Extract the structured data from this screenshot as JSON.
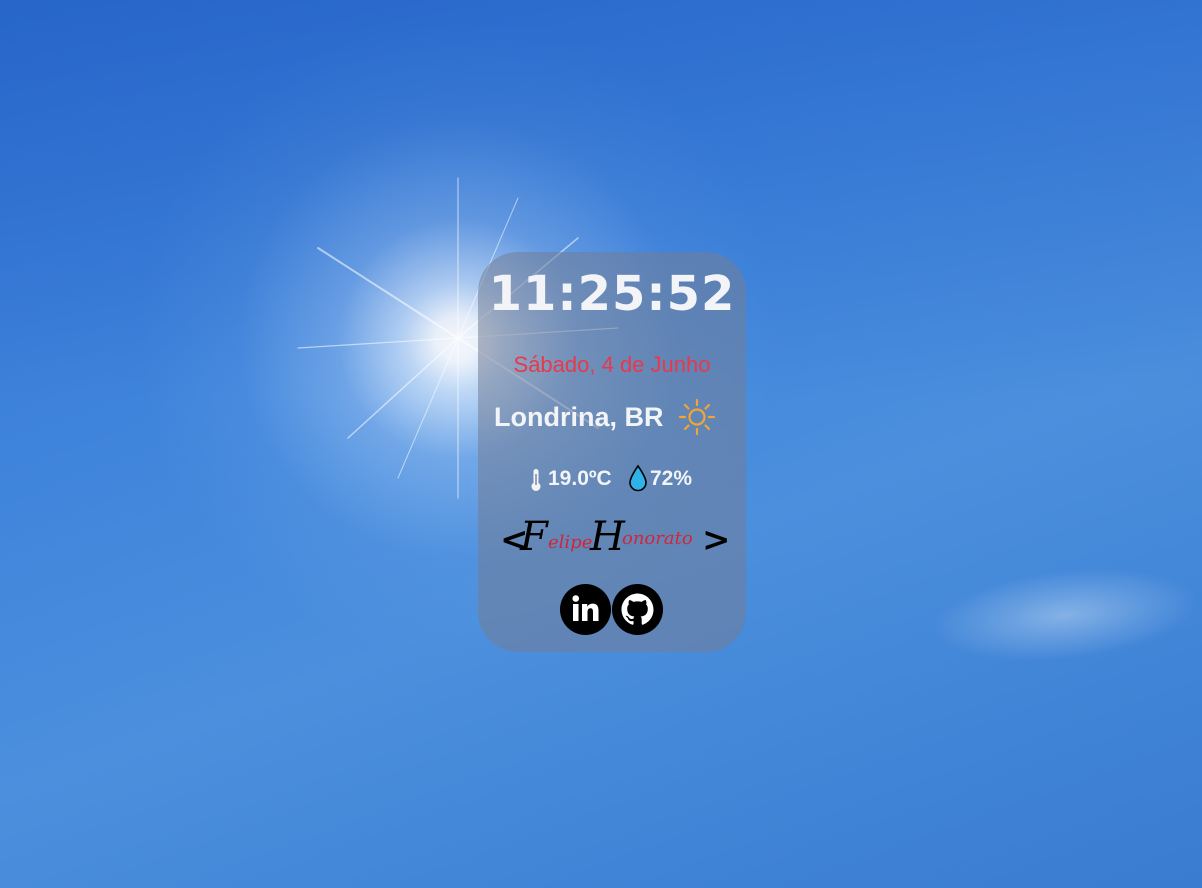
{
  "clock": {
    "time": "11:25:52"
  },
  "date": {
    "label": "Sábado, 4 de Junho"
  },
  "weather": {
    "city": "Londrina, BR",
    "condition_icon": "sun-icon",
    "temperature": "19.0ºC",
    "humidity": "72%",
    "temperature_icon": "thermometer-icon",
    "humidity_icon": "water-drop-icon"
  },
  "signature": {
    "open": "<",
    "first_initial": "F",
    "first_rest": "elipe",
    "last_initial": "H",
    "last_rest": "onorato",
    "close": ">"
  },
  "socials": [
    {
      "name": "LinkedIn",
      "icon": "linkedin-icon"
    },
    {
      "name": "GitHub",
      "icon": "github-icon"
    }
  ],
  "colors": {
    "date": "#e8394a",
    "text": "#f2f4f8",
    "sun_icon": "#f2a531",
    "drop_icon": "#2fb2e8",
    "card_bg": "rgba(115,125,150,0.55)"
  }
}
